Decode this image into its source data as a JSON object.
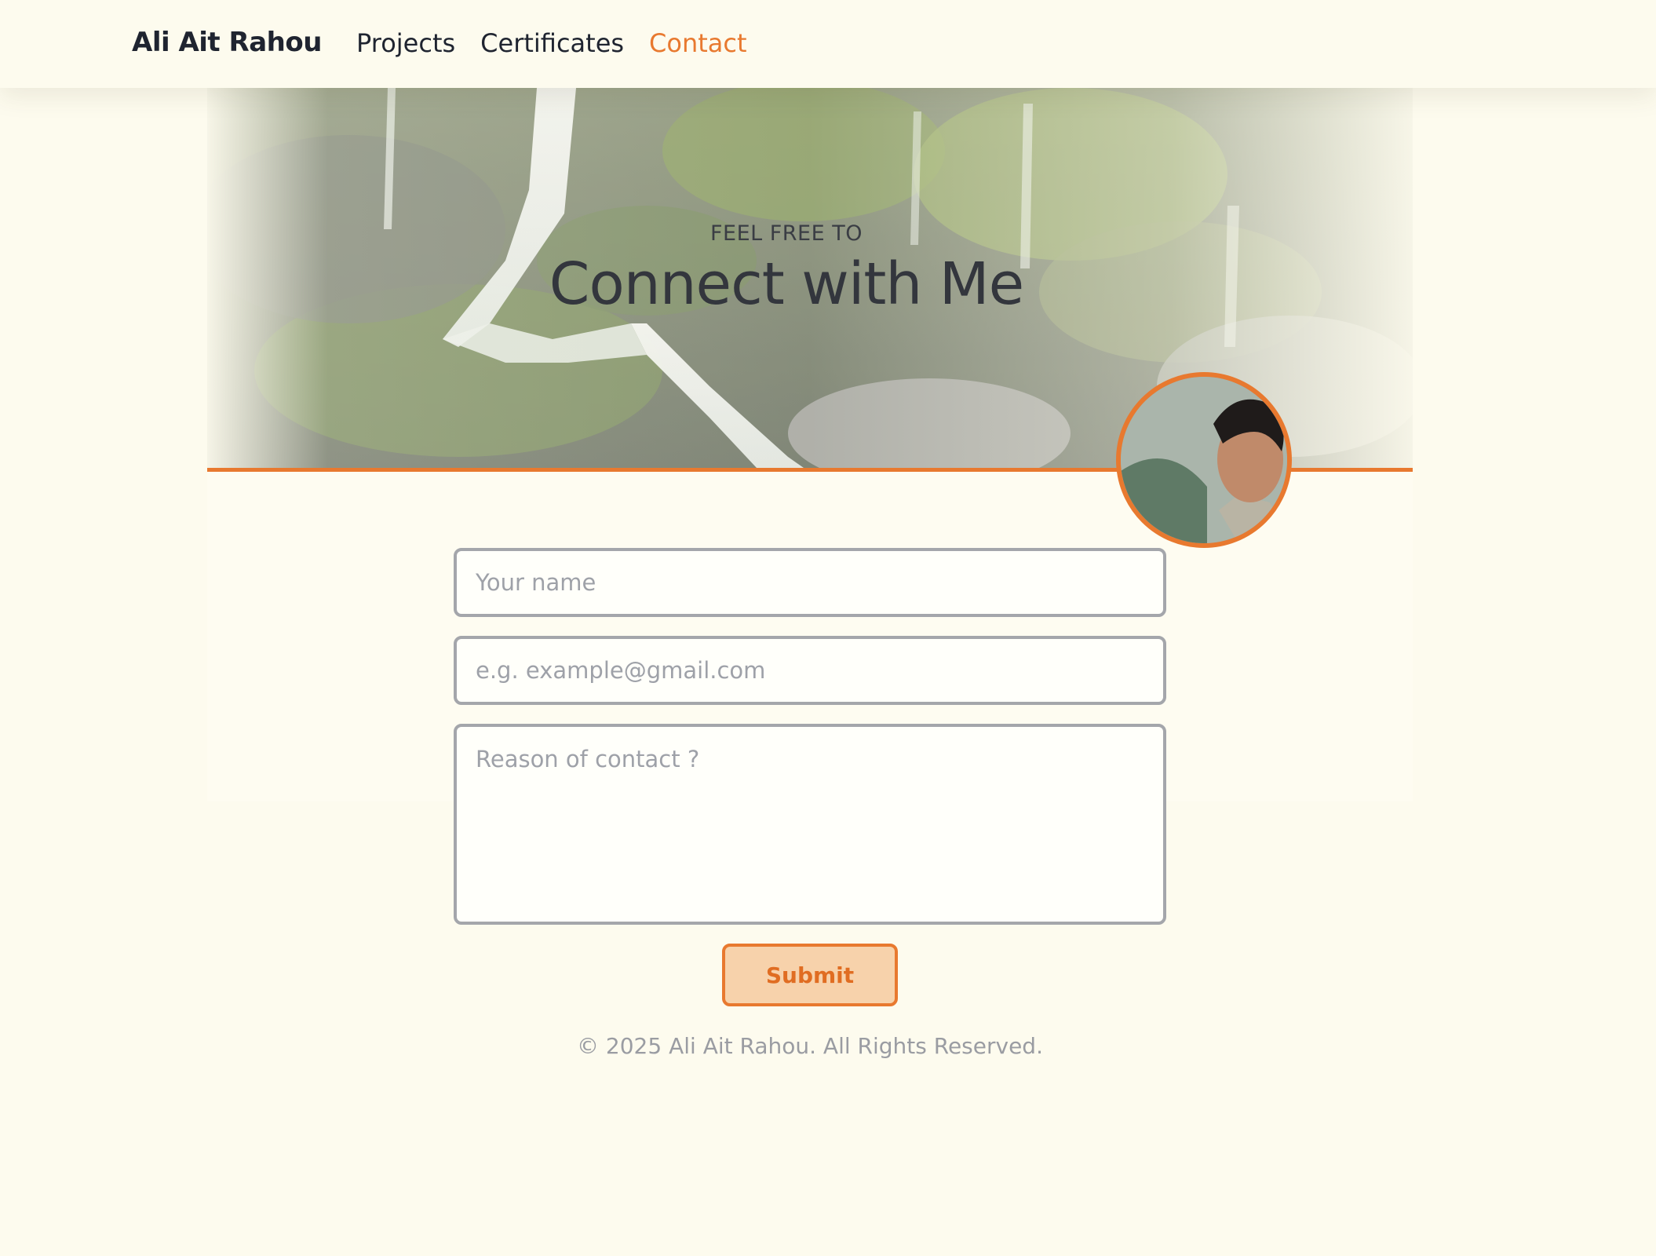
{
  "nav": {
    "brand": "Ali Ait Rahou",
    "links": [
      {
        "label": "Projects"
      },
      {
        "label": "Certificates"
      },
      {
        "label": "Contact"
      }
    ],
    "active_link": "Contact",
    "theme_toggle_icon": "moon-icon"
  },
  "hero": {
    "eyebrow": "FEEL FREE TO",
    "title": "Connect with Me",
    "background_image": "waterfall-photo",
    "avatar_image": "profile-photo"
  },
  "form": {
    "name_placeholder": "Your name",
    "email_placeholder": "e.g. example@gmail.com",
    "reason_placeholder": "Reason of contact ?",
    "name_value": "",
    "email_value": "",
    "reason_value": "",
    "submit_label": "Submit"
  },
  "footer": {
    "text": "© 2025 Ali Ait Rahou. All Rights Reserved."
  },
  "colors": {
    "accent": "#e8792f",
    "background": "#fdfbee",
    "submit_fill": "#f7d2ab",
    "input_border": "#a4a6ab"
  }
}
